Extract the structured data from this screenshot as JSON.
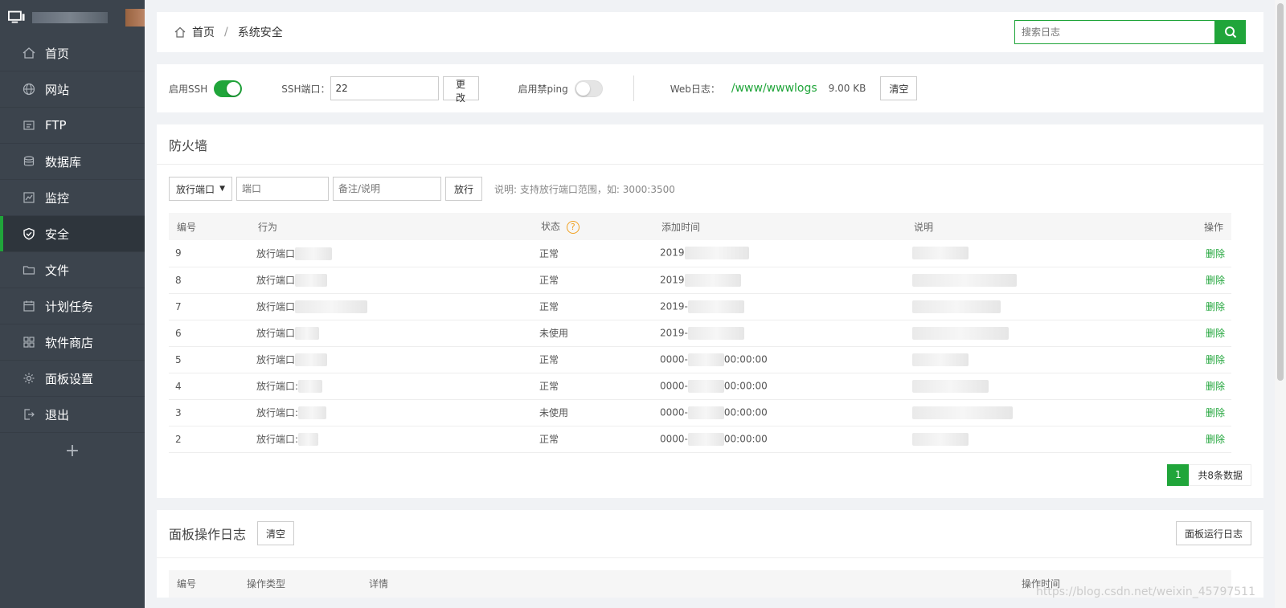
{
  "sidebar": {
    "items": [
      {
        "label": "首页",
        "icon": "home-icon"
      },
      {
        "label": "网站",
        "icon": "globe-icon"
      },
      {
        "label": "FTP",
        "icon": "ftp-icon"
      },
      {
        "label": "数据库",
        "icon": "database-icon"
      },
      {
        "label": "监控",
        "icon": "monitor-icon"
      },
      {
        "label": "安全",
        "icon": "shield-check-icon",
        "active": true
      },
      {
        "label": "文件",
        "icon": "folder-icon"
      },
      {
        "label": "计划任务",
        "icon": "calendar-icon"
      },
      {
        "label": "软件商店",
        "icon": "apps-icon"
      },
      {
        "label": "面板设置",
        "icon": "gear-icon"
      },
      {
        "label": "退出",
        "icon": "logout-icon"
      }
    ],
    "add_label": "+"
  },
  "breadcrumb": {
    "home": "首页",
    "separator": "/",
    "current": "系统安全"
  },
  "search": {
    "placeholder": "搜索日志"
  },
  "settings": {
    "ssh_label": "启用SSH",
    "ssh_enabled": true,
    "ssh_port_label": "SSH端口：",
    "ssh_port_value": "22",
    "change_button": "更改",
    "ping_label": "启用禁ping",
    "ping_enabled": false,
    "weblog_label": "Web日志：",
    "weblog_path": "/www/wwwlogs",
    "weblog_size": "9.00 KB",
    "clear_button": "清空"
  },
  "firewall": {
    "title": "防火墙",
    "select_value": "放行端口",
    "port_placeholder": "端口",
    "note_placeholder": "备注/说明",
    "allow_button": "放行",
    "hint": "说明: 支持放行端口范围，如: 3000:3500",
    "columns": [
      "编号",
      "行为",
      "状态",
      "添加时间",
      "说明",
      "操作"
    ],
    "rows": [
      {
        "id": "9",
        "action": "放行端口",
        "status": "正常",
        "time": "2019",
        "del": "删除"
      },
      {
        "id": "8",
        "action": "放行端口",
        "status": "正常",
        "time": "2019",
        "del": "删除"
      },
      {
        "id": "7",
        "action": "放行端口",
        "status": "正常",
        "time": "2019-",
        "del": "删除"
      },
      {
        "id": "6",
        "action": "放行端口",
        "status": "未使用",
        "time": "2019-",
        "del": "删除"
      },
      {
        "id": "5",
        "action": "放行端口",
        "status": "正常",
        "time": "0000-",
        "time_tail": "00:00:00",
        "del": "删除"
      },
      {
        "id": "4",
        "action": "放行端口:",
        "status": "正常",
        "time": "0000-",
        "time_tail": "00:00:00",
        "del": "删除"
      },
      {
        "id": "3",
        "action": "放行端口:",
        "status": "未使用",
        "time": "0000-",
        "time_tail": "00:00:00",
        "del": "删除"
      },
      {
        "id": "2",
        "action": "放行端口:",
        "status": "正常",
        "time": "0000-",
        "time_tail": "00:00:00",
        "del": "删除"
      }
    ],
    "page": "1",
    "total": "共8条数据"
  },
  "panel_log": {
    "title": "面板操作日志",
    "clear_button": "清空",
    "run_log_button": "面板运行日志",
    "columns": [
      "编号",
      "操作类型",
      "详情",
      "操作时间"
    ]
  },
  "watermark": "https://blog.csdn.net/weixin_45797511",
  "colors": {
    "accent": "#20a53a",
    "sidebar": "#3c444d",
    "background": "#f0f2f5"
  }
}
